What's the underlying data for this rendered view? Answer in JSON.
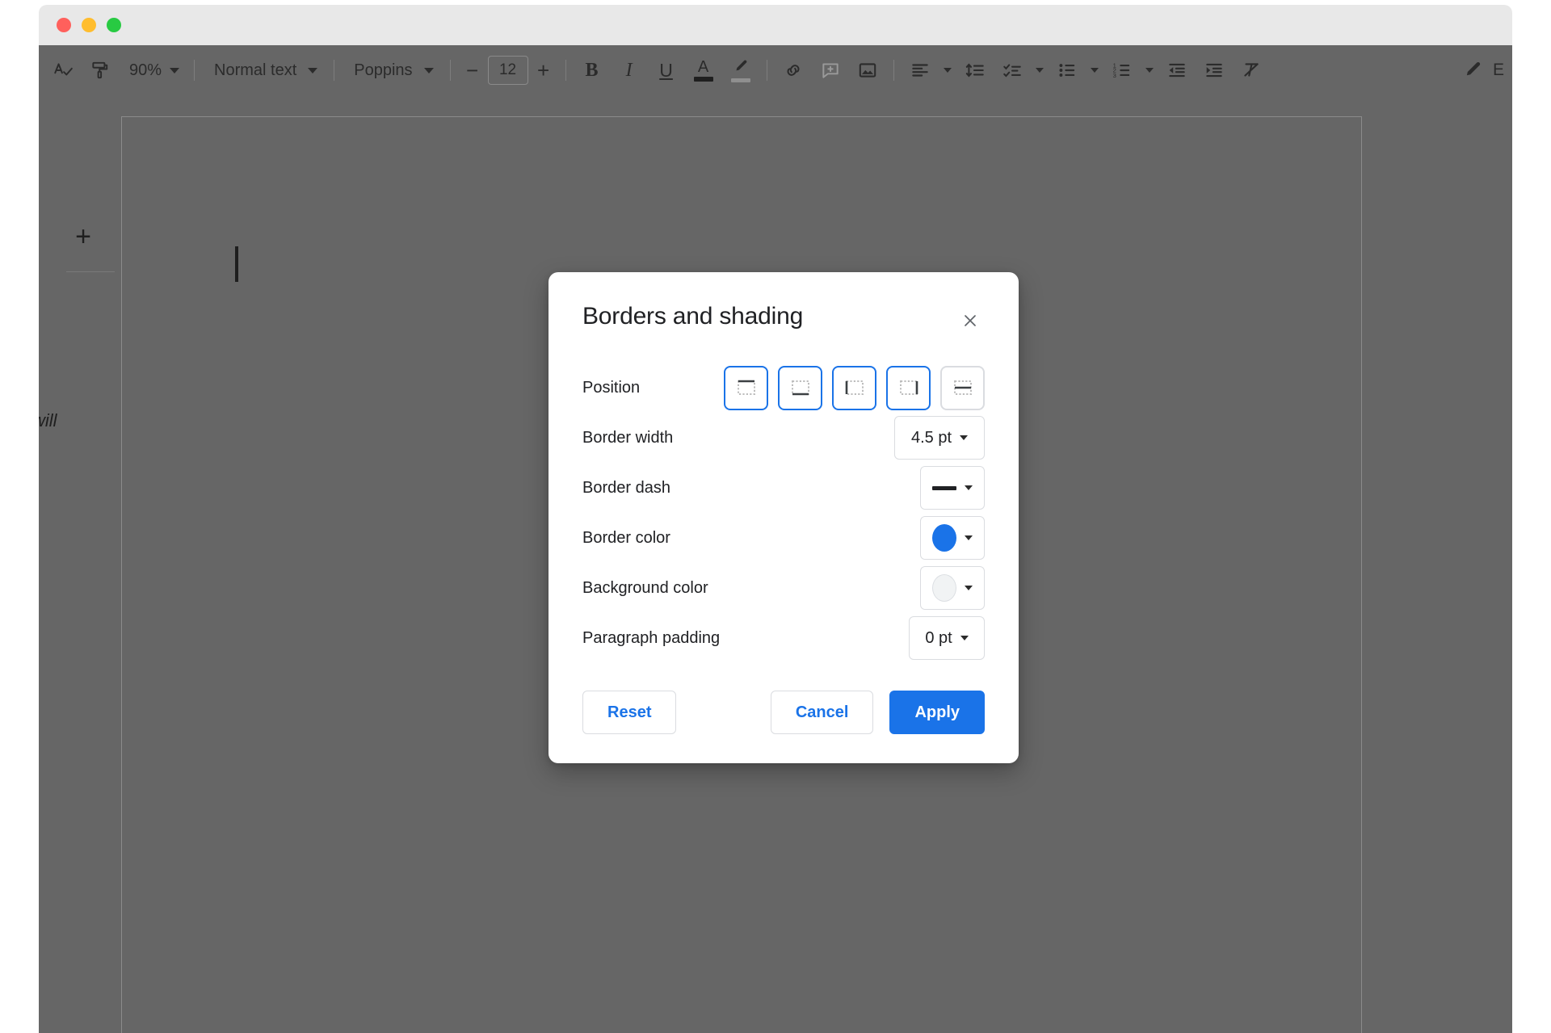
{
  "window": {
    "traffic_lights": [
      {
        "name": "close",
        "color": "#ff605c"
      },
      {
        "name": "minimize",
        "color": "#ffbd2e"
      },
      {
        "name": "zoom",
        "color": "#28ca42"
      }
    ]
  },
  "toolbar": {
    "spelling_icon": "spellcheck-icon",
    "paint_format_icon": "paint-format-icon",
    "zoom_value": "90%",
    "style_value": "Normal text",
    "font_value": "Poppins",
    "font_size_decrease": "−",
    "font_size_value": "12",
    "font_size_increase": "+",
    "bold_label": "B",
    "italic_label": "I",
    "underline_label": "U",
    "text_color_label": "A",
    "highlight_icon": "highlight-pen-icon",
    "link_icon": "link-icon",
    "comment_icon": "add-comment-icon",
    "image_icon": "insert-image-icon",
    "align_icon": "align-left-icon",
    "line_spacing_icon": "line-spacing-icon",
    "checklist_icon": "checklist-icon",
    "bulleted_list_icon": "bulleted-list-icon",
    "numbered_list_icon": "numbered-list-icon",
    "decrease_indent_icon": "decrease-indent-icon",
    "increase_indent_icon": "increase-indent-icon",
    "clear_formatting_icon": "clear-formatting-icon",
    "mode_icon": "pencil-edit-icon",
    "mode_label": "E"
  },
  "outline": {
    "add_label": "+",
    "snippet_text": "will"
  },
  "dialog": {
    "title": "Borders and shading",
    "close_icon": "close-icon",
    "rows": {
      "position": {
        "label": "Position",
        "options": [
          {
            "name": "border-top",
            "icon": "border-top-icon",
            "selected": true
          },
          {
            "name": "border-bottom",
            "icon": "border-bottom-icon",
            "selected": true
          },
          {
            "name": "border-left",
            "icon": "border-left-icon",
            "selected": true
          },
          {
            "name": "border-right",
            "icon": "border-right-icon",
            "selected": true
          },
          {
            "name": "border-between",
            "icon": "border-between-icon",
            "selected": false
          }
        ]
      },
      "border_width": {
        "label": "Border width",
        "value": "4.5 pt"
      },
      "border_dash": {
        "label": "Border dash",
        "value": "solid"
      },
      "border_color": {
        "label": "Border color",
        "value": "#1a73e8"
      },
      "background_color": {
        "label": "Background color",
        "value": "#f1f3f4"
      },
      "paragraph_padding": {
        "label": "Paragraph padding",
        "value": "0 pt"
      }
    },
    "buttons": {
      "reset": "Reset",
      "cancel": "Cancel",
      "apply": "Apply"
    }
  },
  "colors": {
    "accent": "#1a73e8",
    "overlay": "#666666",
    "chrome": "#e8e8e8"
  }
}
